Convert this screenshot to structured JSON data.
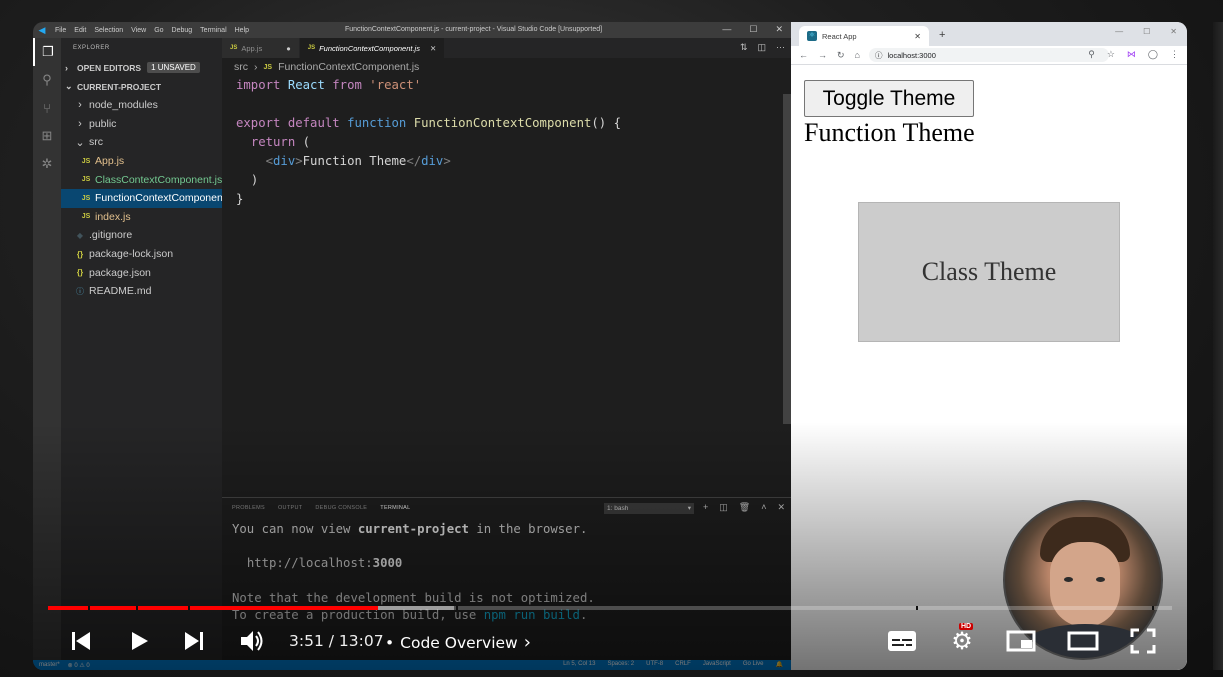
{
  "vscode": {
    "window_title": "FunctionContextComponent.js - current-project - Visual Studio Code [Unsupported]",
    "menu": [
      "File",
      "Edit",
      "Selection",
      "View",
      "Go",
      "Debug",
      "Terminal",
      "Help"
    ],
    "window_controls": [
      "—",
      "☐",
      "✕"
    ],
    "explorer_title": "EXPLORER",
    "open_editors_label": "OPEN EDITORS",
    "unsaved_badge": "1 UNSAVED",
    "project_label": "CURRENT-PROJECT",
    "tree": [
      {
        "name": "node_modules",
        "type": "folder",
        "indent": 1,
        "state": "collapsed"
      },
      {
        "name": "public",
        "type": "folder",
        "indent": 1,
        "state": "collapsed"
      },
      {
        "name": "src",
        "type": "folder",
        "indent": 1,
        "state": "expanded"
      },
      {
        "name": "App.js",
        "type": "js",
        "indent": 2
      },
      {
        "name": "ClassContextComponent.js",
        "type": "js",
        "indent": 2,
        "color": "green"
      },
      {
        "name": "FunctionContextComponent.js",
        "type": "js",
        "indent": 2,
        "selected": true
      },
      {
        "name": "index.js",
        "type": "js",
        "indent": 2
      },
      {
        "name": ".gitignore",
        "type": "git",
        "indent": 1
      },
      {
        "name": "package-lock.json",
        "type": "json",
        "indent": 1
      },
      {
        "name": "package.json",
        "type": "json",
        "indent": 1
      },
      {
        "name": "README.md",
        "type": "info",
        "indent": 1
      }
    ],
    "tabs": [
      {
        "label": "App.js",
        "dirty": true
      },
      {
        "label": "FunctionContextComponent.js",
        "active": true
      }
    ],
    "breadcrumb": [
      "src",
      "FunctionContextComponent.js"
    ],
    "code": {
      "l1": {
        "kw": "import",
        "name": "React",
        "from": "from",
        "str": "'react'"
      },
      "l3": {
        "export": "export",
        "default": "default",
        "function": "function",
        "fname": "FunctionContextComponent",
        "rest": "() {"
      },
      "l4": {
        "ret": "return",
        "paren": "("
      },
      "l5": {
        "open": "div",
        "text": "Function Theme",
        "close": "div"
      },
      "l6": ")",
      "l7": "}"
    },
    "panel_tabs": [
      "PROBLEMS",
      "OUTPUT",
      "DEBUG CONSOLE",
      "TERMINAL"
    ],
    "terminal_select": "1: bash",
    "terminal": {
      "l1a": "You can now view ",
      "l1b": "current-project",
      "l1c": " in the browser.",
      "l2a": "http://localhost:",
      "l2b": "3000",
      "l3": "Note that the development build is not optimized.",
      "l4a": "To create a production build, use ",
      "l4b": "npm run build",
      "l4c": "."
    },
    "status": {
      "branch": "master*",
      "errors": "⊗ 0 ⚠ 0",
      "position": "Ln 5, Col 13",
      "spaces": "Spaces: 2",
      "encoding": "UTF-8",
      "eol": "CRLF",
      "lang": "JavaScript",
      "golive": "Go Live"
    }
  },
  "browser": {
    "tab_title": "React App",
    "url": "localhost:3000",
    "toggle_label": "Toggle Theme",
    "function_theme": "Function Theme",
    "class_theme": "Class Theme"
  },
  "player": {
    "time": "3:51 / 13:07",
    "separator": "•",
    "chapter": "Code Overview",
    "hd": "HD",
    "progress_played": 0.294
  }
}
